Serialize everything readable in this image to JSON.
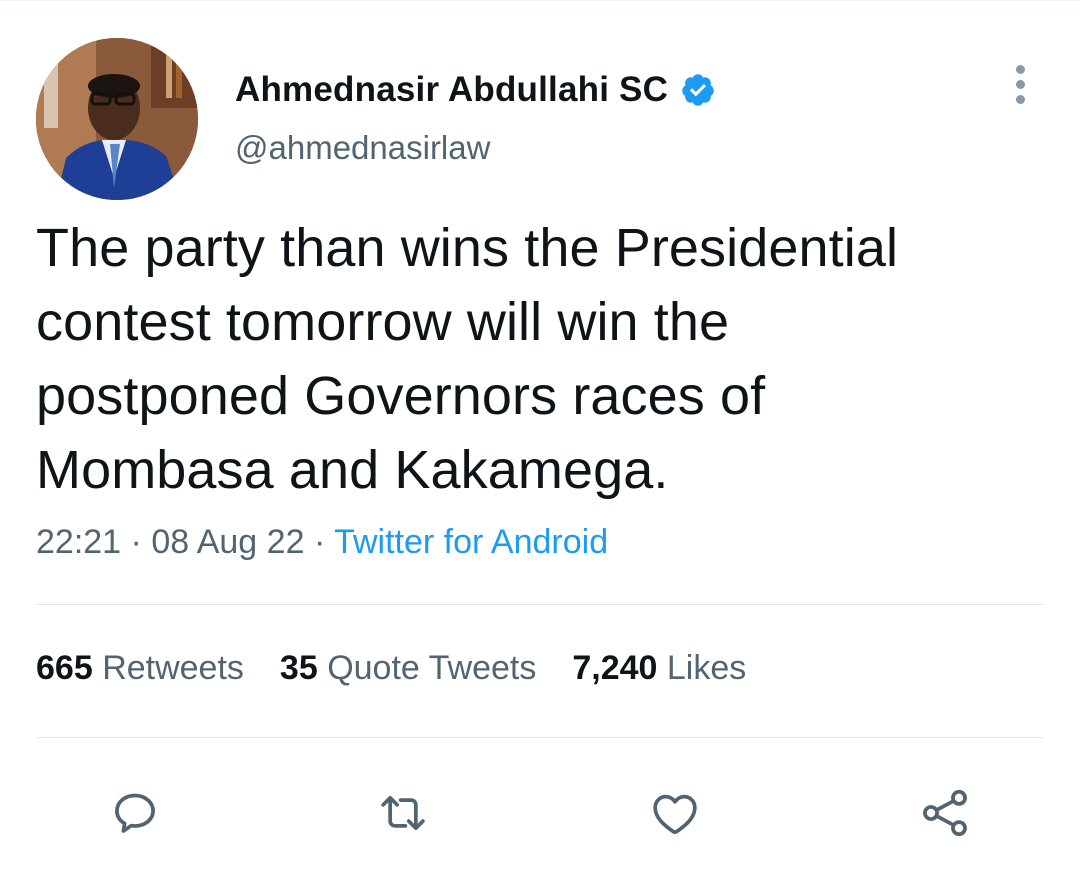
{
  "author": {
    "display_name": "Ahmednasir Abdullahi SC",
    "handle": "@ahmednasirlaw",
    "verified": true,
    "avatar": "profile-photo"
  },
  "tweet": {
    "text": "The party than wins the Presidential\ncontest tomorrow will win the\npostponed Governors races of\nMombasa and Kakamega.",
    "time": "22:21",
    "date": "08 Aug 22",
    "separator": "·",
    "source": "Twitter for Android"
  },
  "stats": {
    "retweets_count": "665",
    "retweets_label": "Retweets",
    "quotes_count": "35",
    "quotes_label": "Quote Tweets",
    "likes_count": "7,240",
    "likes_label": "Likes"
  },
  "actions": [
    {
      "name": "reply",
      "icon": "reply-icon"
    },
    {
      "name": "retweet",
      "icon": "retweet-icon"
    },
    {
      "name": "like",
      "icon": "heart-icon"
    },
    {
      "name": "share",
      "icon": "share-icon"
    }
  ],
  "colors": {
    "text": "#0f1419",
    "secondary": "#536471",
    "accent": "#1d9bf0",
    "divider": "#e1e8ed"
  }
}
